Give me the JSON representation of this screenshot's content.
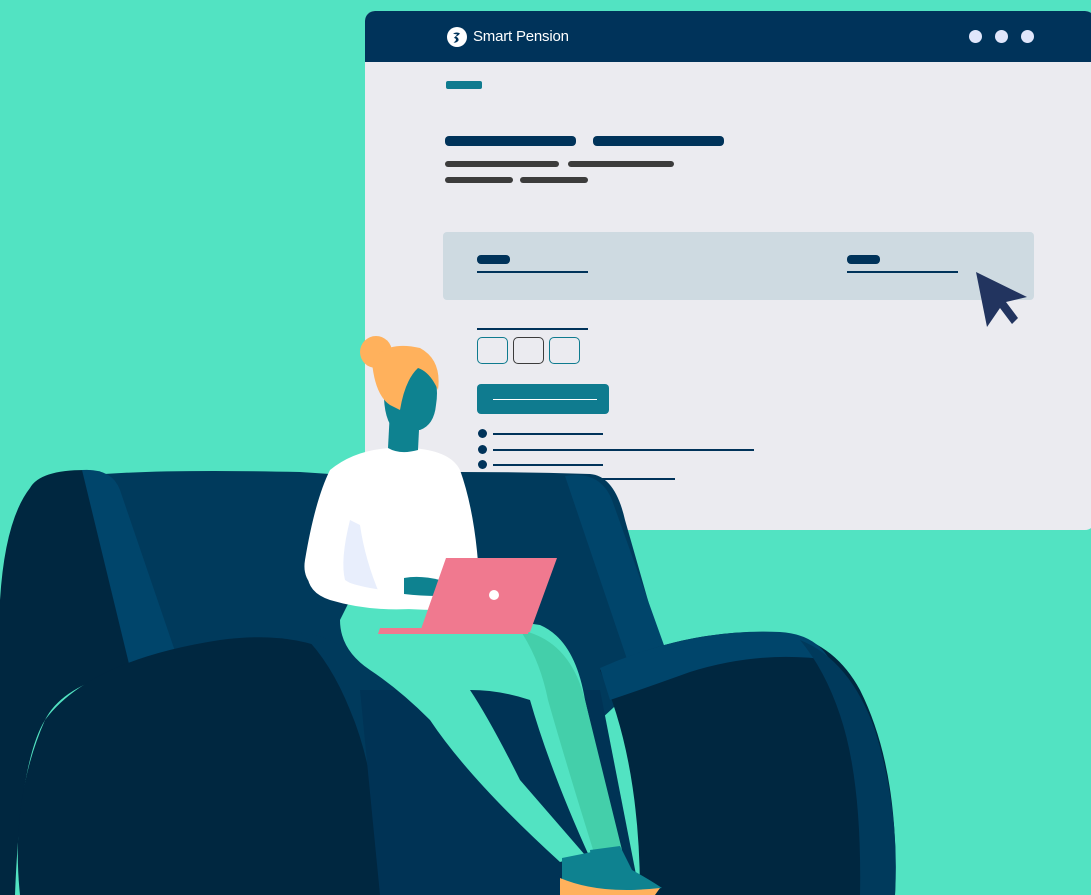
{
  "colors": {
    "background": "#52e3c2",
    "window_body": "#ebebf0",
    "titlebar": "#00335a",
    "navy": "#00335a",
    "teal": "#0f7b8f",
    "gray_text": "#3c3c3c",
    "card": "#cedae1",
    "dots": "#e0e6fb",
    "sofa_dark": "#002740",
    "sofa_mid": "#003a5c",
    "sofa_light": "#004468",
    "hair": "#ffb15c",
    "skin": "#0e8290",
    "shirt": "#ffffff",
    "pants": "#52e3c2",
    "pants_shade": "#44cfaa",
    "laptop": "#f0798f",
    "shoes": "#ffb15c"
  },
  "header": {
    "brand_name": "Smart Pension",
    "logo_icon": "smart-pension-logo-icon",
    "window_controls": [
      "dot",
      "dot",
      "dot"
    ]
  },
  "icons": {
    "cursor": "mouse-pointer-icon"
  }
}
